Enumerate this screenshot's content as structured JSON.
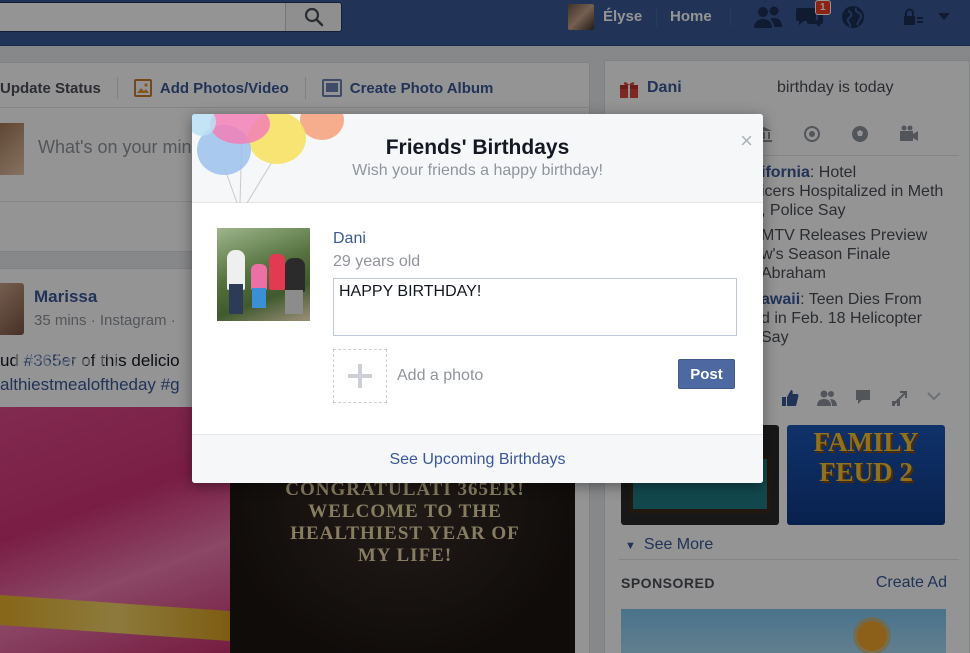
{
  "topbar": {
    "user_name": "Élyse",
    "home_label": "Home",
    "notification_count": "1",
    "icons": [
      "search-icon",
      "friends-icon",
      "messages-icon",
      "globe-icon",
      "privacy-lock-icon",
      "chevron-down-icon"
    ]
  },
  "composer": {
    "tab_status": "Update Status",
    "tab_photos": "Add Photos/Video",
    "tab_album": "Create Photo Album",
    "placeholder": "What's on your min"
  },
  "post": {
    "author": "Marissa",
    "meta": "35 mins · Instagram ·",
    "line1_prefix": "ud ",
    "line1_tag": "#365er",
    "line1_suffix": " of this delicio",
    "line2_tag": "althiestmealoftheday",
    "line2_tag2": "#g",
    "photo_text": "CONGRATULATI 365ER! WELCOME TO THE HEALTHIEST YEAR OF MY LIFE!"
  },
  "watermark": "Pocketlint",
  "sidebar": {
    "birthday_name": "Dani",
    "birthday_text": "birthday is today",
    "trends": [
      {
        "bold": "ifornia",
        "rest": ": Hotel",
        "line2": "icers Hospitalized in Meth",
        "line3": ", Police Say"
      },
      {
        "bold": "",
        "rest": "MTV Releases Preview",
        "line2": "w's Season Finale",
        "line3": "Abraham"
      },
      {
        "bold": "awaii",
        "rest": ": Teen Dies From",
        "line2": "d in Feb. 18 Helicopter",
        "line3": "Say"
      }
    ],
    "game2_title": "FAMILY FEUD 2",
    "see_more": "See More",
    "sponsored": "SPONSORED",
    "create_ad": "Create Ad"
  },
  "dialog": {
    "title": "Friends' Birthdays",
    "subtitle": "Wish your friends a happy birthday!",
    "close": "×",
    "friend_name": "Dani",
    "friend_age": "29 years old",
    "message": "HAPPY BIRTHDAY!",
    "add_photo": "Add a photo",
    "post_button": "Post",
    "upcoming_link": "See Upcoming Birthdays"
  },
  "colors": {
    "brand": "#3b5998",
    "post_button": "#4e69a2",
    "badge": "#f03d25"
  }
}
